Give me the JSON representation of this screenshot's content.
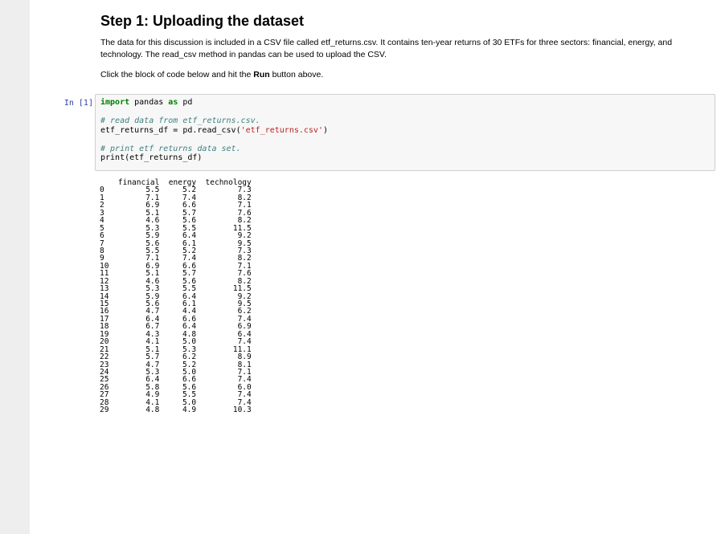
{
  "markdown": {
    "heading": "Step 1: Uploading the dataset",
    "para1": "The data for this discussion is included in a CSV file called etf_returns.csv. It contains ten-year returns of 30 ETFs for three sectors: financial, energy, and technology. The read_csv method in pandas can be used to upload the CSV.",
    "para2_prefix": "Click the block of code below and hit the ",
    "para2_bold": "Run",
    "para2_suffix": " button above."
  },
  "cell": {
    "prompt": "In [1]:",
    "code": {
      "line1_kw1": "import",
      "line1_mid": " pandas ",
      "line1_kw2": "as",
      "line1_end": " pd",
      "line3_comment": "# read data from etf_returns.csv.",
      "line4_pre": "etf_returns_df = pd.read_csv(",
      "line4_str": "'etf_returns.csv'",
      "line4_post": ")",
      "line6_comment": "# print etf returns data set.",
      "line7": "print(etf_returns_df)"
    }
  },
  "output": {
    "columns": [
      "financial",
      "energy",
      "technology"
    ],
    "rows": [
      [
        "0",
        "5.5",
        "5.2",
        "7.3"
      ],
      [
        "1",
        "7.1",
        "7.4",
        "8.2"
      ],
      [
        "2",
        "6.9",
        "6.6",
        "7.1"
      ],
      [
        "3",
        "5.1",
        "5.7",
        "7.6"
      ],
      [
        "4",
        "4.6",
        "5.6",
        "8.2"
      ],
      [
        "5",
        "5.3",
        "5.5",
        "11.5"
      ],
      [
        "6",
        "5.9",
        "6.4",
        "9.2"
      ],
      [
        "7",
        "5.6",
        "6.1",
        "9.5"
      ],
      [
        "8",
        "5.5",
        "5.2",
        "7.3"
      ],
      [
        "9",
        "7.1",
        "7.4",
        "8.2"
      ],
      [
        "10",
        "6.9",
        "6.6",
        "7.1"
      ],
      [
        "11",
        "5.1",
        "5.7",
        "7.6"
      ],
      [
        "12",
        "4.6",
        "5.6",
        "8.2"
      ],
      [
        "13",
        "5.3",
        "5.5",
        "11.5"
      ],
      [
        "14",
        "5.9",
        "6.4",
        "9.2"
      ],
      [
        "15",
        "5.6",
        "6.1",
        "9.5"
      ],
      [
        "16",
        "4.7",
        "4.4",
        "6.2"
      ],
      [
        "17",
        "6.4",
        "6.6",
        "7.4"
      ],
      [
        "18",
        "6.7",
        "6.4",
        "6.9"
      ],
      [
        "19",
        "4.3",
        "4.8",
        "6.4"
      ],
      [
        "20",
        "4.1",
        "5.0",
        "7.4"
      ],
      [
        "21",
        "5.1",
        "5.3",
        "11.1"
      ],
      [
        "22",
        "5.7",
        "6.2",
        "8.9"
      ],
      [
        "23",
        "4.7",
        "5.2",
        "8.1"
      ],
      [
        "24",
        "5.3",
        "5.0",
        "7.1"
      ],
      [
        "25",
        "6.4",
        "6.6",
        "7.4"
      ],
      [
        "26",
        "5.8",
        "5.6",
        "6.0"
      ],
      [
        "27",
        "4.9",
        "5.5",
        "7.4"
      ],
      [
        "28",
        "4.1",
        "5.0",
        "7.4"
      ],
      [
        "29",
        "4.8",
        "4.9",
        "10.3"
      ]
    ]
  }
}
